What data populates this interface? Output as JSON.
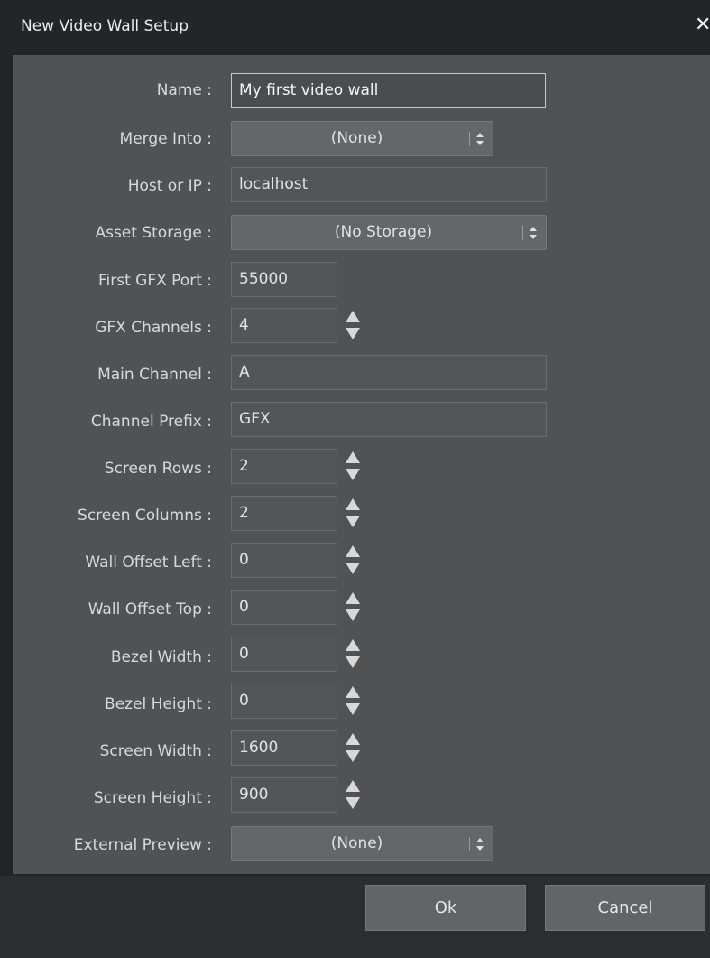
{
  "window": {
    "title": "New Video Wall Setup",
    "close_glyph": "✕"
  },
  "form": {
    "name": {
      "label": "Name :",
      "value": "My first video wall"
    },
    "merge_into": {
      "label": "Merge Into :",
      "value": "(None)"
    },
    "host_or_ip": {
      "label": "Host or IP :",
      "value": "localhost"
    },
    "asset_storage": {
      "label": "Asset Storage :",
      "value": "(No Storage)"
    },
    "first_gfx_port": {
      "label": "First GFX Port :",
      "value": "55000"
    },
    "gfx_channels": {
      "label": "GFX Channels :",
      "value": "4"
    },
    "main_channel": {
      "label": "Main Channel :",
      "value": "A"
    },
    "channel_prefix": {
      "label": "Channel Prefix :",
      "value": "GFX"
    },
    "screen_rows": {
      "label": "Screen Rows :",
      "value": "2"
    },
    "screen_columns": {
      "label": "Screen Columns :",
      "value": "2"
    },
    "wall_offset_left": {
      "label": "Wall Offset Left :",
      "value": "0"
    },
    "wall_offset_top": {
      "label": "Wall Offset Top :",
      "value": "0"
    },
    "bezel_width": {
      "label": "Bezel Width :",
      "value": "0"
    },
    "bezel_height": {
      "label": "Bezel Height :",
      "value": "0"
    },
    "screen_width": {
      "label": "Screen Width :",
      "value": "1600"
    },
    "screen_height": {
      "label": "Screen Height :",
      "value": "900"
    },
    "external_preview": {
      "label": "External Preview :",
      "value": "(None)"
    }
  },
  "buttons": {
    "ok": "Ok",
    "cancel": "Cancel"
  },
  "icons": {
    "close": "close-icon",
    "dropdown": "updown-chevron-icon",
    "spinner": "spinner-arrows-icon"
  }
}
